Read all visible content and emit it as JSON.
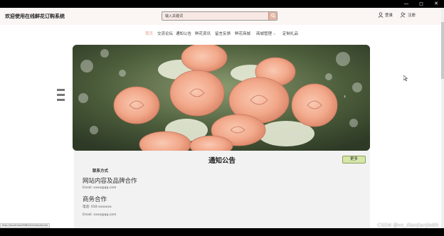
{
  "window": {
    "controls": [
      "—",
      "◻",
      "✕"
    ]
  },
  "header": {
    "site_title": "欢迎使用在线鲜花订购系统",
    "search_placeholder": "输入关键词",
    "login_label": "登录",
    "register_label": "注册"
  },
  "nav": {
    "items": [
      {
        "label": "首页",
        "active": true
      },
      {
        "label": "交流论坛"
      },
      {
        "label": "通知公告"
      },
      {
        "label": "鲜花资讯"
      },
      {
        "label": "留言反馈"
      },
      {
        "label": "鲜花商城"
      },
      {
        "label": "商城管理"
      },
      {
        "label": "定制礼品"
      }
    ]
  },
  "notice": {
    "title": "通知公告",
    "more_label": "更多",
    "contact_label": "联系方式",
    "sections": [
      {
        "title": "网站内容及品牌合作",
        "lines": [
          "Email:  xxxx@qq.com"
        ]
      },
      {
        "title": "商务合作",
        "lines": [
          "电话:  010-xxxxxxx",
          "Email:  xxxx@qq.com"
        ]
      }
    ]
  },
  "status": {
    "url": "http://localhost:8080/#/index/home"
  },
  "watermark": "CSDN @vx_dianjianjie89",
  "colors": {
    "accent": "#e0a08a",
    "more_button": "#d5e6a8",
    "notice_bg": "#f2f2f2"
  }
}
